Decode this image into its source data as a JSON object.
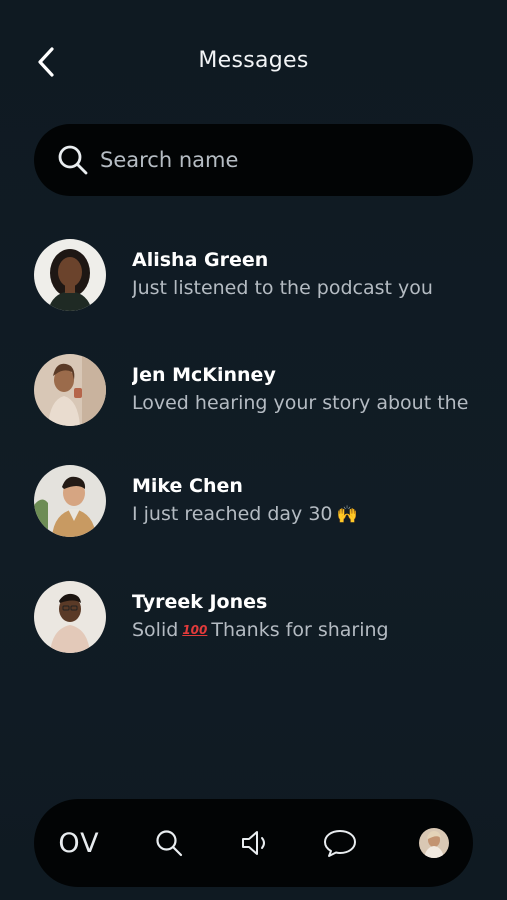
{
  "header": {
    "title": "Messages",
    "back_icon": "chevron-left-icon"
  },
  "search": {
    "placeholder": "Search name",
    "value": "",
    "icon": "search-icon"
  },
  "conversations": [
    {
      "name": "Alisha Green",
      "preview": "Just listened to the podcast you"
    },
    {
      "name": "Jen McKinney",
      "preview": "Loved hearing your story about the"
    },
    {
      "name": "Mike Chen",
      "preview": "I just reached day 30",
      "emoji": "🙌"
    },
    {
      "name": "Tyreek Jones",
      "preview_before": "Solid",
      "emoji": "100",
      "preview_after": "Thanks for sharing"
    }
  ],
  "nav": {
    "logo": "OV",
    "items": [
      "search-icon",
      "speaker-icon",
      "chat-bubble-icon",
      "profile-avatar"
    ]
  },
  "colors": {
    "background": "#101a22",
    "surface": "#020405",
    "text_primary": "#ffffff",
    "text_secondary": "#b4bbc2"
  }
}
